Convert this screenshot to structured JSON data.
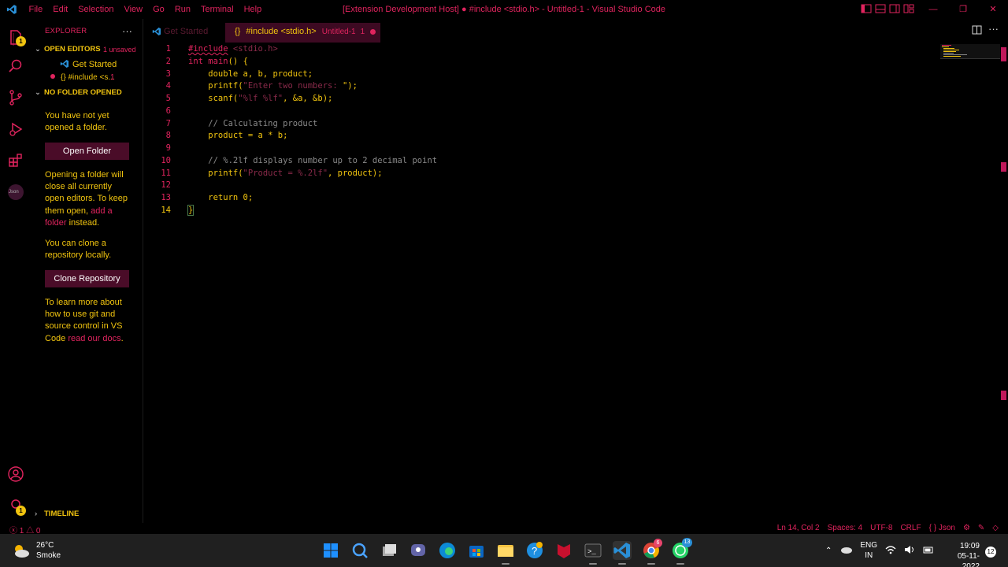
{
  "titlebar": {
    "menu": [
      "File",
      "Edit",
      "Selection",
      "View",
      "Go",
      "Run",
      "Terminal",
      "Help"
    ],
    "title": "[Extension Development Host] ● #include <stdio.h> - Untitled-1 - Visual Studio Code"
  },
  "activity": {
    "explorer_badge": "1",
    "settings_badge": "1",
    "json_label": "Json"
  },
  "sidebar": {
    "header": "EXPLORER",
    "more": "···",
    "open_editors": {
      "title": "OPEN EDITORS",
      "unsaved": "1 unsaved"
    },
    "open_items": [
      {
        "label": "Get Started"
      },
      {
        "label": "{} #include <s...",
        "count": "1"
      }
    ],
    "no_folder": {
      "title": "NO FOLDER OPENED"
    },
    "msg1": "You have not yet opened a folder.",
    "open_folder_btn": "Open Folder",
    "msg2_a": "Opening a folder will close all currently open editors. To keep them open, ",
    "msg2_link": "add a folder",
    "msg2_b": " instead.",
    "msg3": "You can clone a repository locally.",
    "clone_btn": "Clone Repository",
    "msg4_a": "To learn more about how to use git and source control in VS Code ",
    "msg4_link": "read our docs",
    "msg4_b": ".",
    "timeline": "TIMELINE"
  },
  "tabs": {
    "tab1": "Get Started",
    "tab2_icon": "{}",
    "tab2_label": "#include <stdio.h>",
    "tab2_desc": "Untitled-1",
    "tab2_count": "1"
  },
  "editor": {
    "lines": [
      "#include <stdio.h>",
      "int main() {",
      "    double a, b, product;",
      "    printf(\"Enter two numbers: \");",
      "    scanf(\"%lf %lf\", &a, &b);",
      "",
      "    // Calculating product",
      "    product = a * b;",
      "",
      "    // %.2lf displays number up to 2 decimal point",
      "    printf(\"Product = %.2lf\", product);",
      "",
      "    return 0;",
      "}"
    ]
  },
  "statusbar": {
    "errors": "1",
    "warnings": "0",
    "position": "Ln 14, Col 2",
    "spaces": "Spaces: 4",
    "encoding": "UTF-8",
    "eol": "CRLF",
    "language": "{ } Json"
  },
  "taskbar": {
    "temp": "26°C",
    "weather": "Smoke",
    "lang1": "ENG",
    "lang2": "IN",
    "time": "19:09",
    "date": "05-11-2022",
    "notifications": "12",
    "chrome_badge": "6",
    "whatsapp_badge": "13"
  }
}
